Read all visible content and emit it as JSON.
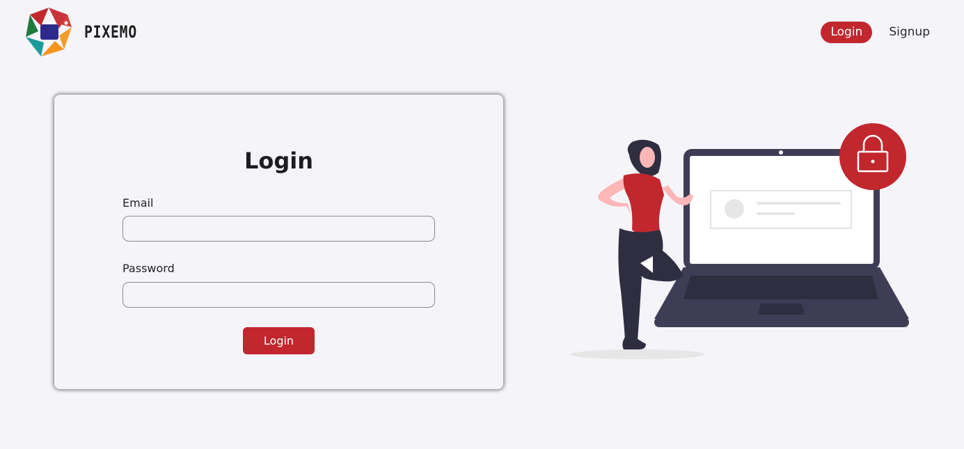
{
  "brand": {
    "name": "PIXEMO"
  },
  "nav": {
    "login_label": "Login",
    "signup_label": "Signup"
  },
  "form": {
    "title": "Login",
    "email_label": "Email",
    "email_value": "",
    "password_label": "Password",
    "password_value": "",
    "submit_label": "Login"
  },
  "colors": {
    "accent": "#c1272d",
    "background": "#f5f5f9",
    "laptop": "#3f3d56"
  },
  "icons": {
    "logo": "pixemo-logo-icon",
    "lock": "lock-icon"
  }
}
